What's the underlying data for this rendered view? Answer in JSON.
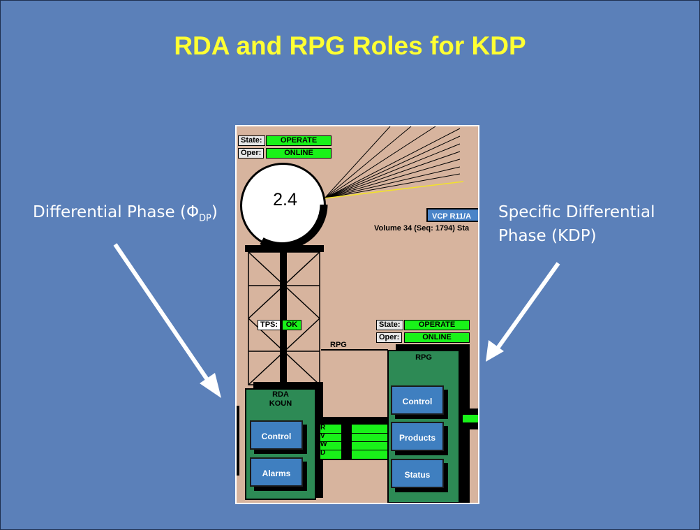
{
  "slide": {
    "title": "RDA and RPG Roles for KDP",
    "left_label_main": "Differential Phase (Φ",
    "left_label_sub": "DP",
    "left_label_close": ")",
    "right_label_line1": "Specific Differential",
    "right_label_line2": "Phase (KDP)"
  },
  "hci": {
    "rda_state": {
      "label": "State:",
      "value": "OPERATE"
    },
    "rda_oper": {
      "label": "Oper:",
      "value": "ONLINE"
    },
    "elevation": "2.4",
    "vcp": "VCP R11/A",
    "volume": "Volume 34 (Seq: 1794) Sta",
    "tps": {
      "label": "TPS:",
      "value": "OK"
    },
    "rpg_line_label": "RPG",
    "rpg_state": {
      "label": "State:",
      "value": "OPERATE"
    },
    "rpg_oper": {
      "label": "Oper:",
      "value": "ONLINE"
    },
    "rda_block": {
      "title_line1": "RDA",
      "title_line2": "KOUN",
      "buttons": [
        "Control",
        "Alarms"
      ]
    },
    "rpg_block": {
      "title": "RPG",
      "buttons": [
        "Control",
        "Products",
        "Status"
      ]
    },
    "bus_letters": [
      "R",
      "V",
      "W",
      "D"
    ]
  },
  "colors": {
    "background": "#5b80b9",
    "title": "#ffff33",
    "panel": "#d7b49e",
    "status_green": "#19f219",
    "block_green": "#2d8a55",
    "button_blue": "#3f7fc0"
  }
}
